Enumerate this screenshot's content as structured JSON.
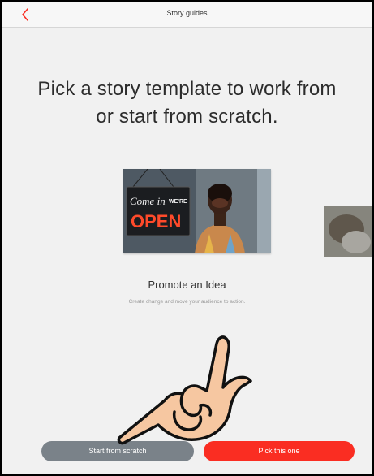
{
  "navbar": {
    "title": "Story guides",
    "back_icon": "chevron-left-icon",
    "back_color": "#fa2d22"
  },
  "headline": "Pick a story template to work from or start from scratch.",
  "template": {
    "title": "Promote an Idea",
    "description": "Create change and move your audience to action.",
    "sign_lines": [
      "Come in",
      "WE'RE",
      "OPEN"
    ]
  },
  "buttons": {
    "scratch_label": "Start from scratch",
    "pick_label": "Pick this one",
    "scratch_color": "#7a8289",
    "pick_color": "#fa2d22"
  }
}
